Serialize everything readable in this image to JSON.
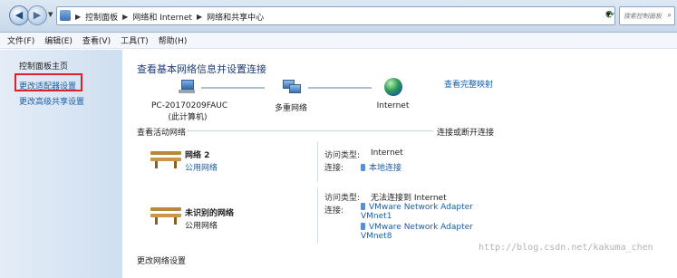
{
  "address_bar": {
    "crumbs": [
      "控制面板",
      "网络和 Internet",
      "网络和共享中心"
    ],
    "search_placeholder": "搜索控制面板"
  },
  "menu": [
    "文件(F)",
    "编辑(E)",
    "查看(V)",
    "工具(T)",
    "帮助(H)"
  ],
  "sidebar": {
    "items": [
      "控制面板主页",
      "更改适配器设置",
      "更改高级共享设置"
    ]
  },
  "main": {
    "title": "查看基本网络信息并设置连接",
    "see_full_map": "查看完整映射",
    "map_nodes": [
      {
        "label": "PC-20170209FAUC",
        "sublabel": "(此计算机)"
      },
      {
        "label": "多重网络"
      },
      {
        "label": "Internet"
      }
    ],
    "active_networks_label": "查看活动网络",
    "connect_disconnect": "连接或断开连接",
    "networks": [
      {
        "name": "网络  2",
        "type": "公用网络",
        "access_type_label": "访问类型:",
        "access_type": "Internet",
        "connections_label": "连接:",
        "connections": [
          "本地连接"
        ]
      },
      {
        "name": "未识别的网络",
        "type": "公用网络",
        "access_type_label": "访问类型:",
        "access_type": "无法连接到 Internet",
        "connections_label": "连接:",
        "connections": [
          "VMware Network Adapter VMnet1",
          "VMware Network Adapter VMnet8"
        ]
      }
    ],
    "change_settings_label": "更改网络设置"
  },
  "watermark": "http://blog.csdn.net/kakuma_chen"
}
